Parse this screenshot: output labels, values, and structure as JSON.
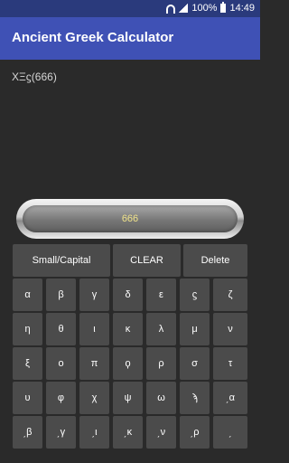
{
  "status_bar": {
    "battery": "100%",
    "time": "14:49"
  },
  "app_bar": {
    "title": "Ancient Greek Calculator"
  },
  "expression": "ΧΞϛ(666)",
  "display": {
    "value": "666"
  },
  "controls": {
    "small_capital": "Small/Capital",
    "clear": "CLEAR",
    "delete": "Delete"
  },
  "keys": [
    [
      "α",
      "β",
      "γ",
      "δ",
      "ε",
      "ϛ",
      "ζ"
    ],
    [
      "η",
      "θ",
      "ι",
      "κ",
      "λ",
      "μ",
      "ν"
    ],
    [
      "ξ",
      "ο",
      "π",
      "ϙ",
      "ρ",
      "σ",
      "τ"
    ],
    [
      "υ",
      "φ",
      "χ",
      "ψ",
      "ω",
      "ϡ",
      "͵α"
    ],
    [
      "͵β",
      "͵γ",
      "͵ι",
      "͵κ",
      "͵ν",
      "͵ρ",
      "͵"
    ]
  ]
}
